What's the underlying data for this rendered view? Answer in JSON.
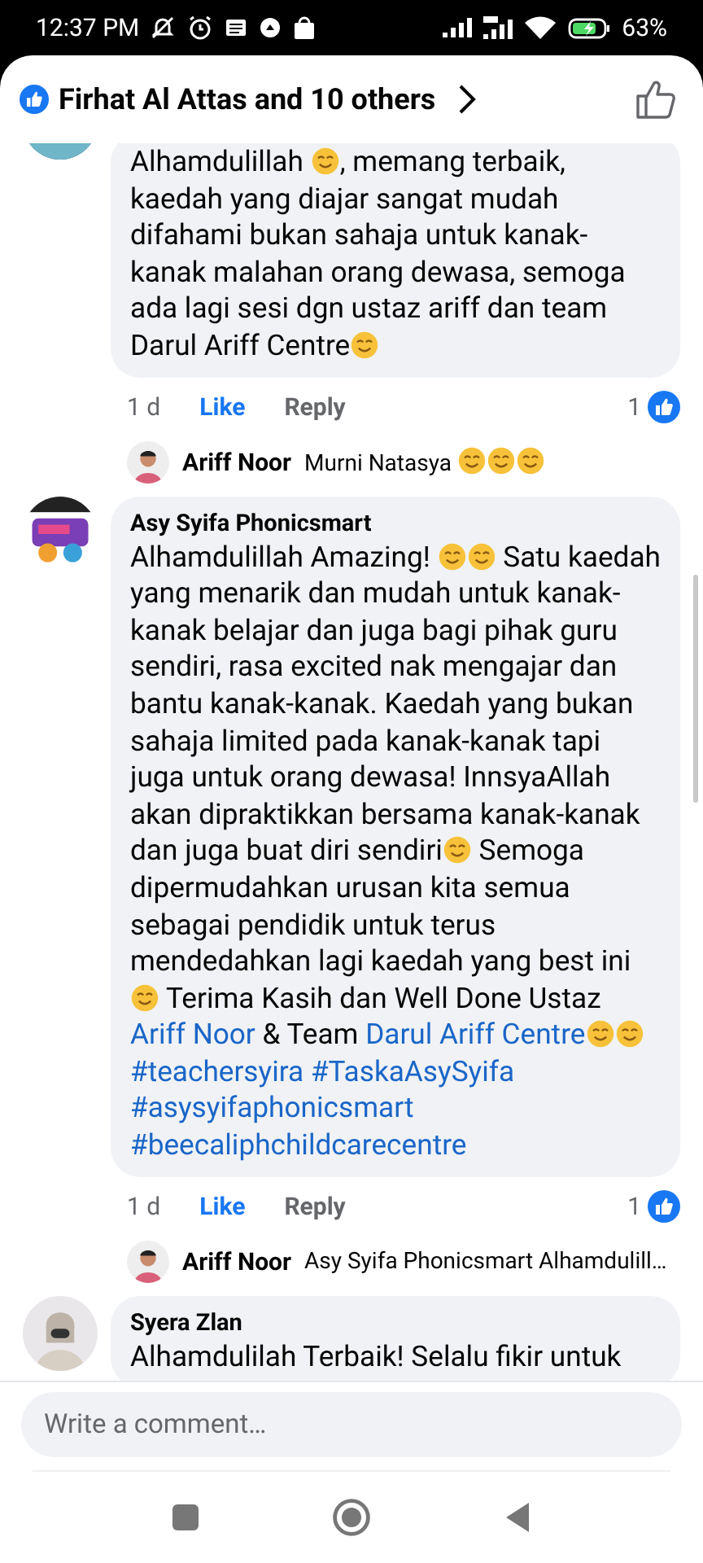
{
  "status_bar": {
    "time": "12:37 PM",
    "battery": "63%"
  },
  "header": {
    "title": "Firhat Al Attas and 10 others"
  },
  "comments": [
    {
      "body": [
        {
          "kind": "text",
          "text": "Alhamdulillah "
        },
        {
          "kind": "emoji"
        },
        {
          "kind": "text",
          "text": ", memang terbaik, kaedah yang diajar sangat mudah difahami bukan sahaja untuk kanak-kanak malahan orang dewasa, semoga ada lagi sesi dgn ustaz ariff dan team Darul Ariff Centre"
        },
        {
          "kind": "emoji"
        }
      ],
      "time": "1 d",
      "like": "Like",
      "liked": true,
      "reply": "Reply",
      "reactions": "1",
      "replies": [
        {
          "author": "Ariff Noor",
          "body": [
            {
              "kind": "text",
              "text": "Murni Natasya "
            },
            {
              "kind": "emoji"
            },
            {
              "kind": "emoji"
            },
            {
              "kind": "emoji"
            }
          ]
        }
      ]
    },
    {
      "author": "Asy Syifa Phonicsmart",
      "body": [
        {
          "kind": "text",
          "text": "Alhamdulillah Amazing! "
        },
        {
          "kind": "emoji"
        },
        {
          "kind": "emoji"
        },
        {
          "kind": "text",
          "text": " Satu kaedah yang menarik dan mudah untuk kanak-kanak belajar dan juga bagi pihak guru sendiri, rasa excited nak mengajar dan bantu kanak-kanak. Kaedah yang bukan sahaja limited pada kanak-kanak tapi juga untuk orang dewasa! InnsyaAllah akan dipraktikkan bersama kanak-kanak dan juga buat diri sendiri"
        },
        {
          "kind": "emoji"
        },
        {
          "kind": "text",
          "text": " Semoga dipermudahkan urusan kita semua sebagai pendidik untuk terus mendedahkan lagi kaedah yang best ini "
        },
        {
          "kind": "emoji"
        },
        {
          "kind": "text",
          "text": " Terima Kasih dan Well Done Ustaz "
        },
        {
          "kind": "link",
          "text": "Ariff Noor"
        },
        {
          "kind": "text",
          "text": " & Team "
        },
        {
          "kind": "link",
          "text": "Darul Ariff Centre"
        },
        {
          "kind": "emoji"
        },
        {
          "kind": "emoji"
        },
        {
          "kind": "space"
        },
        {
          "kind": "link",
          "text": "#teachersyira"
        },
        {
          "kind": "space"
        },
        {
          "kind": "link",
          "text": "#TaskaAsySyifa"
        },
        {
          "kind": "space"
        },
        {
          "kind": "link",
          "text": "#asysyifaphonicsmart"
        },
        {
          "kind": "space"
        },
        {
          "kind": "link",
          "text": "#beecaliphchildcarecentre"
        }
      ],
      "time": "1 d",
      "like": "Like",
      "liked": true,
      "reply": "Reply",
      "reactions": "1",
      "replies": [
        {
          "author": "Ariff Noor",
          "body": [
            {
              "kind": "text",
              "text": "Asy Syifa Phonicsmart Alhamdulill…"
            }
          ]
        }
      ]
    },
    {
      "author": "Syera Zlan",
      "body": [
        {
          "kind": "text",
          "text": "Alhamdulilah Terbaik! Selalu fikir untuk"
        }
      ]
    }
  ],
  "composer": {
    "placeholder": "Write a comment…"
  }
}
